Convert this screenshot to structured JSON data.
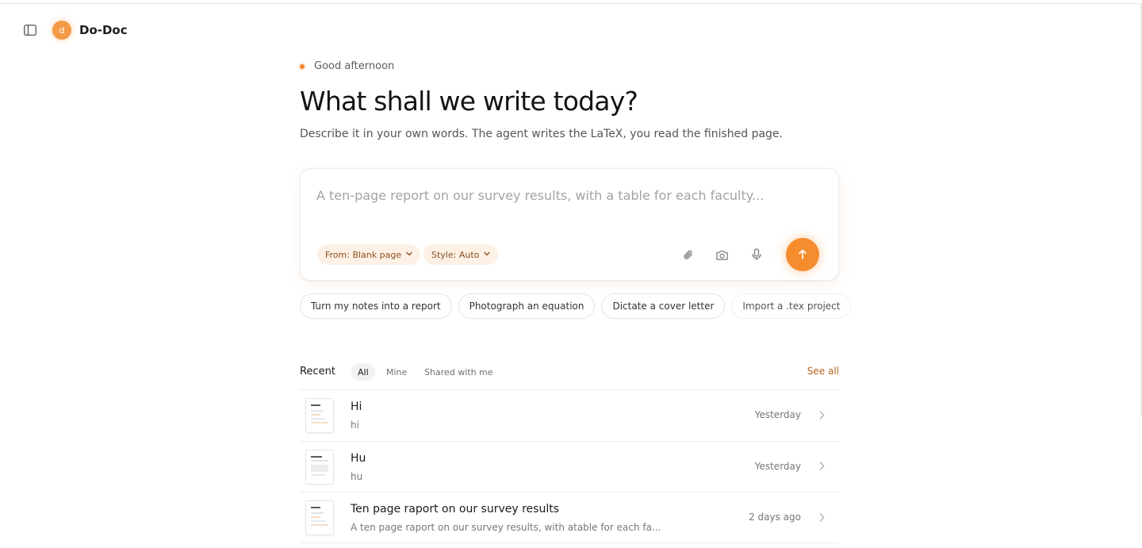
{
  "app": {
    "name": "Do-Doc",
    "avatar_letter": "d"
  },
  "greeting": "Good afternoon",
  "headline": "What shall we write today?",
  "subtitle": "Describe it in your own words. The agent writes the LaTeX, you read the finished page.",
  "composer": {
    "placeholder": "A ten-page report on our survey results, with a table for each faculty...",
    "from_label": "From: Blank page",
    "style_label": "Style: Auto",
    "icons": [
      "paperclip-icon",
      "camera-icon",
      "microphone-icon",
      "arrow-up-icon"
    ]
  },
  "suggestions": [
    "Turn my notes into a report",
    "Photograph an equation",
    "Dictate a cover letter",
    "Import a .tex project"
  ],
  "recent": {
    "title": "Recent",
    "tabs": [
      "All",
      "Mine",
      "Shared with me"
    ],
    "active_tab": "All",
    "see_all": "See all",
    "items": [
      {
        "title": "Hi",
        "subtitle": "hi",
        "time": "Yesterday"
      },
      {
        "title": "Hu",
        "subtitle": "hu",
        "time": "Yesterday"
      },
      {
        "title": "Ten page raport on our survey results",
        "subtitle": "A ten page raport on our survey results, with atable for each fa...",
        "time": "2 days ago"
      }
    ]
  },
  "colors": {
    "accent": "#f58c2e",
    "pill_bg": "#fdf1e6",
    "pill_text": "#8a4f1e",
    "link": "#b4611c"
  }
}
